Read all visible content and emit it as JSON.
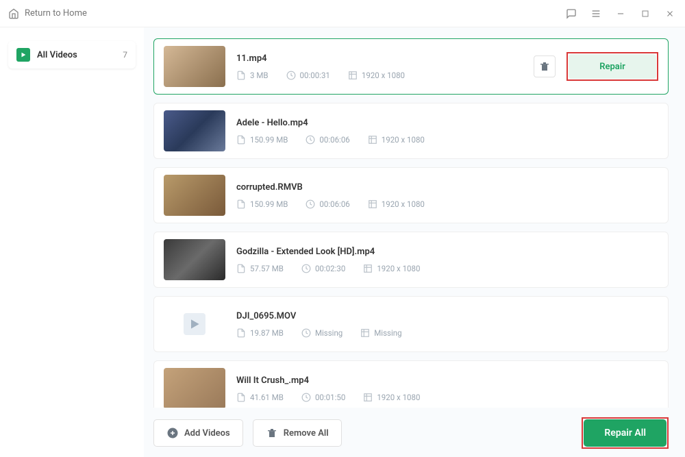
{
  "titlebar": {
    "home_label": "Return to Home"
  },
  "sidebar": {
    "label": "All Videos",
    "count": "7"
  },
  "videos": [
    {
      "name": "11.mp4",
      "size": "3 MB",
      "duration": "00:00:31",
      "resolution": "1920 x 1080",
      "selected": true,
      "thumb_class": "t1"
    },
    {
      "name": "Adele - Hello.mp4",
      "size": "150.99 MB",
      "duration": "00:06:06",
      "resolution": "1920 x 1080",
      "selected": false,
      "thumb_class": "t2"
    },
    {
      "name": "corrupted.RMVB",
      "size": "150.99 MB",
      "duration": "00:06:06",
      "resolution": "1920 x 1080",
      "selected": false,
      "thumb_class": "t3"
    },
    {
      "name": "Godzilla - Extended Look [HD].mp4",
      "size": "57.57 MB",
      "duration": "00:02:30",
      "resolution": "1920 x 1080",
      "selected": false,
      "thumb_class": "t4"
    },
    {
      "name": "DJI_0695.MOV",
      "size": "19.87 MB",
      "duration": "Missing",
      "resolution": "Missing",
      "selected": false,
      "thumb_class": "placeholder"
    },
    {
      "name": "Will It Crush_.mp4",
      "size": "41.61 MB",
      "duration": "00:01:50",
      "resolution": "1920 x 1080",
      "selected": false,
      "thumb_class": "t6"
    }
  ],
  "actions": {
    "repair": "Repair",
    "add_videos": "Add Videos",
    "remove_all": "Remove All",
    "repair_all": "Repair All"
  }
}
